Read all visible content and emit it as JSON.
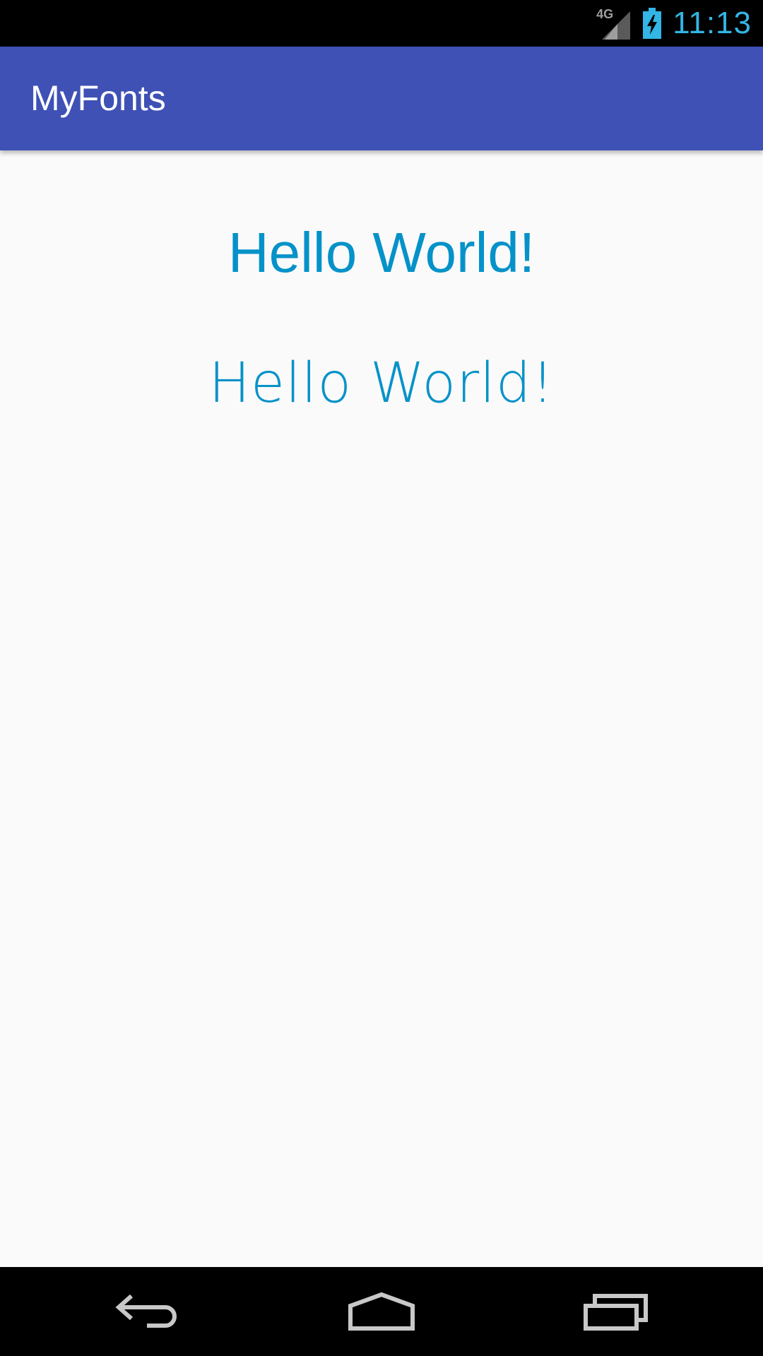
{
  "status_bar": {
    "network_label": "4G",
    "clock": "11:13",
    "clock_color": "#33b5e5",
    "icons": [
      "signal-icon",
      "battery-charging-icon"
    ]
  },
  "app_bar": {
    "title": "MyFonts",
    "color": "#3f51b5"
  },
  "content": {
    "text_color": "#0592c9",
    "hello_default_font": "Hello World!",
    "hello_custom_font": "Hello World!"
  },
  "nav_bar": {
    "buttons": [
      "back-icon",
      "home-icon",
      "recents-icon"
    ]
  }
}
